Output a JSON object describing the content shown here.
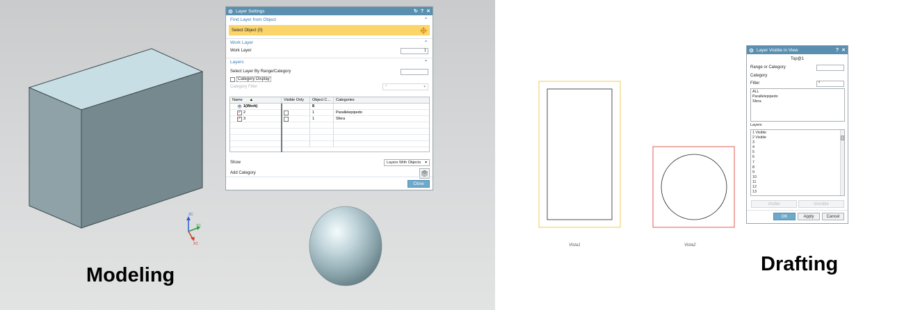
{
  "modeling": {
    "label": "Modeling",
    "triad": {
      "z": "ZC",
      "y": "YC",
      "x": "XC"
    }
  },
  "drafting": {
    "label": "Drafting"
  },
  "layer_settings": {
    "title": "Layer Settings",
    "title_buttons": [
      "↻",
      "?",
      "✕"
    ],
    "find_layer": {
      "header": "Find Layer from Object",
      "select_object": "Select Object (0)"
    },
    "work_layer": {
      "header": "Work Layer",
      "label": "Work Layer",
      "value": "1"
    },
    "layers": {
      "header": "Layers",
      "select_by_range_label": "Select Layer By Range/Category",
      "select_by_range_value": "",
      "category_display_label": "Category Display",
      "category_filter_label": "Category Filter",
      "category_filter_value": "*",
      "columns": [
        "Name",
        "Visible Only",
        "Object C...",
        "Categories"
      ],
      "rows": [
        {
          "name": "1(Work)",
          "visible_only": "",
          "count": "8",
          "category": ""
        },
        {
          "name": "2",
          "visible_only": "",
          "count": "1",
          "category": "Parallelepipedo"
        },
        {
          "name": "3",
          "visible_only": "",
          "count": "1",
          "category": "Sfera"
        }
      ],
      "show_label": "Show",
      "show_value": "Layers With Objects",
      "add_category_label": "Add Category"
    },
    "close_button": "Close"
  },
  "layer_visible": {
    "title": "Layer Visible in View",
    "title_buttons": [
      "?",
      "✕"
    ],
    "view_name": "Top@1",
    "range_label": "Range or Category",
    "range_value": "",
    "category_label": "Category",
    "filter_label": "Filter",
    "filter_value": "*",
    "categories": [
      "ALL",
      "Parallelepipedo",
      "Sfera"
    ],
    "layers_label": "Layers",
    "layers": [
      "1 Visible",
      "2 Visible",
      "3",
      "4",
      "5",
      "6",
      "7",
      "8",
      "9",
      "10",
      "11",
      "12",
      "13"
    ],
    "visible_button": "Visible",
    "invisible_button": "Invisible",
    "ok_button": "OK",
    "apply_button": "Apply",
    "cancel_button": "Cancel"
  },
  "views": [
    {
      "label": "Vista1"
    },
    {
      "label": "Vista2"
    }
  ],
  "colors": {
    "title_bar": "#5a8fb0",
    "section_header": "#3a7cb5",
    "selection_highlight": "#fbd46a",
    "box_top": "#c7dfe4",
    "box_front": "#76898f",
    "box_left": "#8ea2a8",
    "view1_border": "#f0c85a",
    "view2_border": "#e05a4f"
  }
}
